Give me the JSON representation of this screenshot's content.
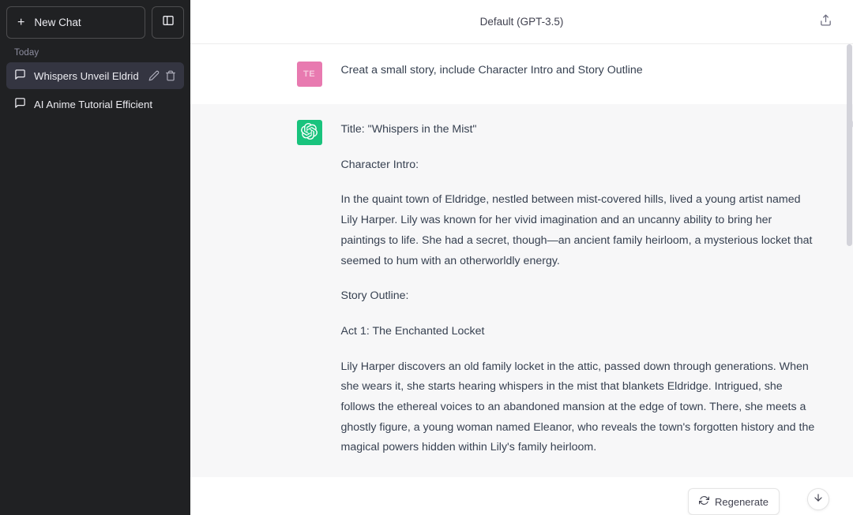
{
  "sidebar": {
    "new_chat_label": "New Chat",
    "new_chat_icon": "plus-icon",
    "panel_toggle_icon": "sidebar-toggle-icon",
    "section_label": "Today",
    "chats": [
      {
        "title": "Whispers Unveil Eldrid",
        "icon": "chat-bubble-icon",
        "active": true,
        "edit_icon": "pencil-icon",
        "delete_icon": "trash-icon"
      },
      {
        "title": "AI Anime Tutorial Efficient",
        "icon": "chat-bubble-icon",
        "active": false
      }
    ],
    "bg_color": "#202123",
    "active_bg_color": "#343541"
  },
  "topbar": {
    "title": "Default (GPT-3.5)",
    "share_icon": "share-upload-icon"
  },
  "messages": [
    {
      "role": "user",
      "avatar_initials": "TE",
      "avatar_color": "#e87ab0",
      "paragraphs": [
        "Creat a small story, include Character Intro and Story Outline"
      ]
    },
    {
      "role": "assistant",
      "avatar_icon": "openai-logo-icon",
      "avatar_color": "#19c37d",
      "actions": [
        "copy-icon",
        "thumbs-up-icon",
        "thumbs-down-icon"
      ],
      "paragraphs": [
        "Title: \"Whispers in the Mist\"",
        "Character Intro:",
        "In the quaint town of Eldridge, nestled between mist-covered hills, lived a young artist named Lily Harper. Lily was known for her vivid imagination and an uncanny ability to bring her paintings to life. She had a secret, though—an ancient family heirloom, a mysterious locket that seemed to hum with an otherworldly energy.",
        "Story Outline:",
        "Act 1: The Enchanted Locket",
        "Lily Harper discovers an old family locket in the attic, passed down through generations. When she wears it, she starts hearing whispers in the mist that blankets Eldridge. Intrigued, she follows the ethereal voices to an abandoned mansion at the edge of town. There, she meets a ghostly figure, a young woman named Eleanor, who reveals the town's forgotten history and the magical powers hidden within Lily's family heirloom."
      ]
    }
  ],
  "footer": {
    "regenerate_label": "Regenerate",
    "regenerate_icon": "refresh-icon",
    "scroll_down_icon": "arrow-down-icon"
  }
}
